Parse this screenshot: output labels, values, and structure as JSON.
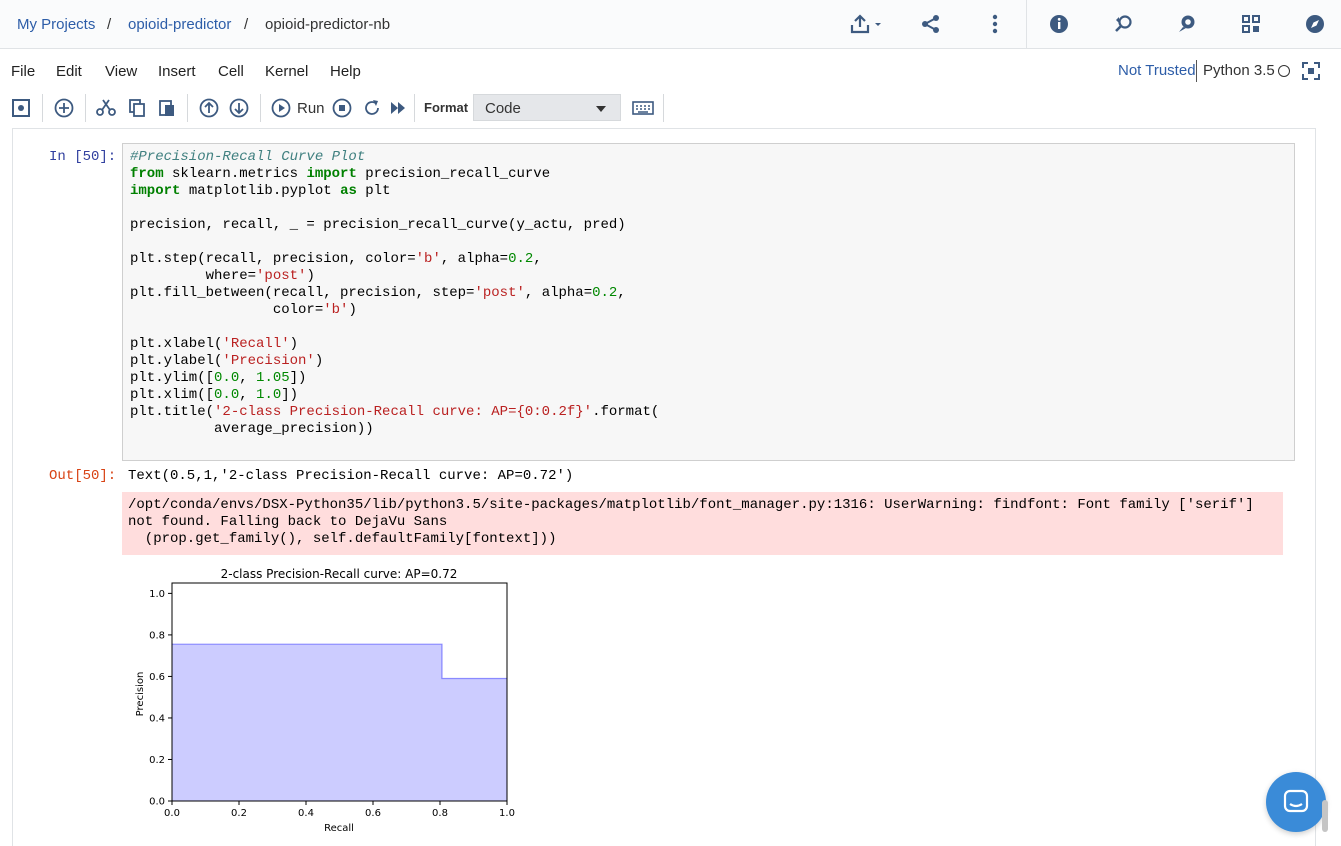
{
  "breadcrumb": {
    "items": [
      "My Projects",
      "opioid-predictor",
      "opioid-predictor-nb"
    ],
    "separator": "/"
  },
  "top_icons": [
    "upload-icon",
    "share-icon",
    "more-vertical-icon",
    "info-icon",
    "find-replace-icon",
    "comments-icon",
    "grid-icon",
    "compass-icon"
  ],
  "menu": [
    "File",
    "Edit",
    "View",
    "Insert",
    "Cell",
    "Kernel",
    "Help"
  ],
  "kernel": {
    "trust": "Not Trusted",
    "name": "Python 3.5"
  },
  "toolbar": {
    "run_label": "Run",
    "format_label": "Format",
    "cell_type": "Code"
  },
  "cell": {
    "in_prompt": "In [50]:",
    "out_prompt": "Out[50]:",
    "code": [
      "#Precision-Recall Curve Plot",
      "from sklearn.metrics import precision_recall_curve",
      "import matplotlib.pyplot as plt",
      "",
      "precision, recall, _ = precision_recall_curve(y_actu, pred)",
      "",
      "plt.step(recall, precision, color='b', alpha=0.2,",
      "         where='post')",
      "plt.fill_between(recall, precision, step='post', alpha=0.2,",
      "                 color='b')",
      "",
      "plt.xlabel('Recall')",
      "plt.ylabel('Precision')",
      "plt.ylim([0.0, 1.05])",
      "plt.xlim([0.0, 1.0])",
      "plt.title('2-class Precision-Recall curve: AP={0:0.2f}'.format(",
      "          average_precision))"
    ],
    "output_text": "Text(0.5,1,'2-class Precision-Recall curve: AP=0.72')",
    "stderr": [
      "/opt/conda/envs/DSX-Python35/lib/python3.5/site-packages/matplotlib/font_manager.py:1316: UserWarning: findfont: Font family ['serif']",
      "not found. Falling back to DejaVu Sans",
      "  (prop.get_family(), self.defaultFamily[fontext]))"
    ]
  },
  "chart_data": {
    "type": "area",
    "title": "2-class Precision-Recall curve: AP=0.72",
    "xlabel": "Recall",
    "ylabel": "Precision",
    "xlim": [
      0.0,
      1.0
    ],
    "ylim": [
      0.0,
      1.05
    ],
    "xticks": [
      "0.0",
      "0.2",
      "0.4",
      "0.6",
      "0.8",
      "1.0"
    ],
    "yticks": [
      "0.0",
      "0.2",
      "0.4",
      "0.6",
      "0.8",
      "1.0"
    ],
    "step": "post",
    "x": [
      0.0,
      0.806,
      1.0
    ],
    "y": [
      0.755,
      0.59,
      0.59
    ],
    "color": "#0000ff",
    "alpha": 0.2
  }
}
